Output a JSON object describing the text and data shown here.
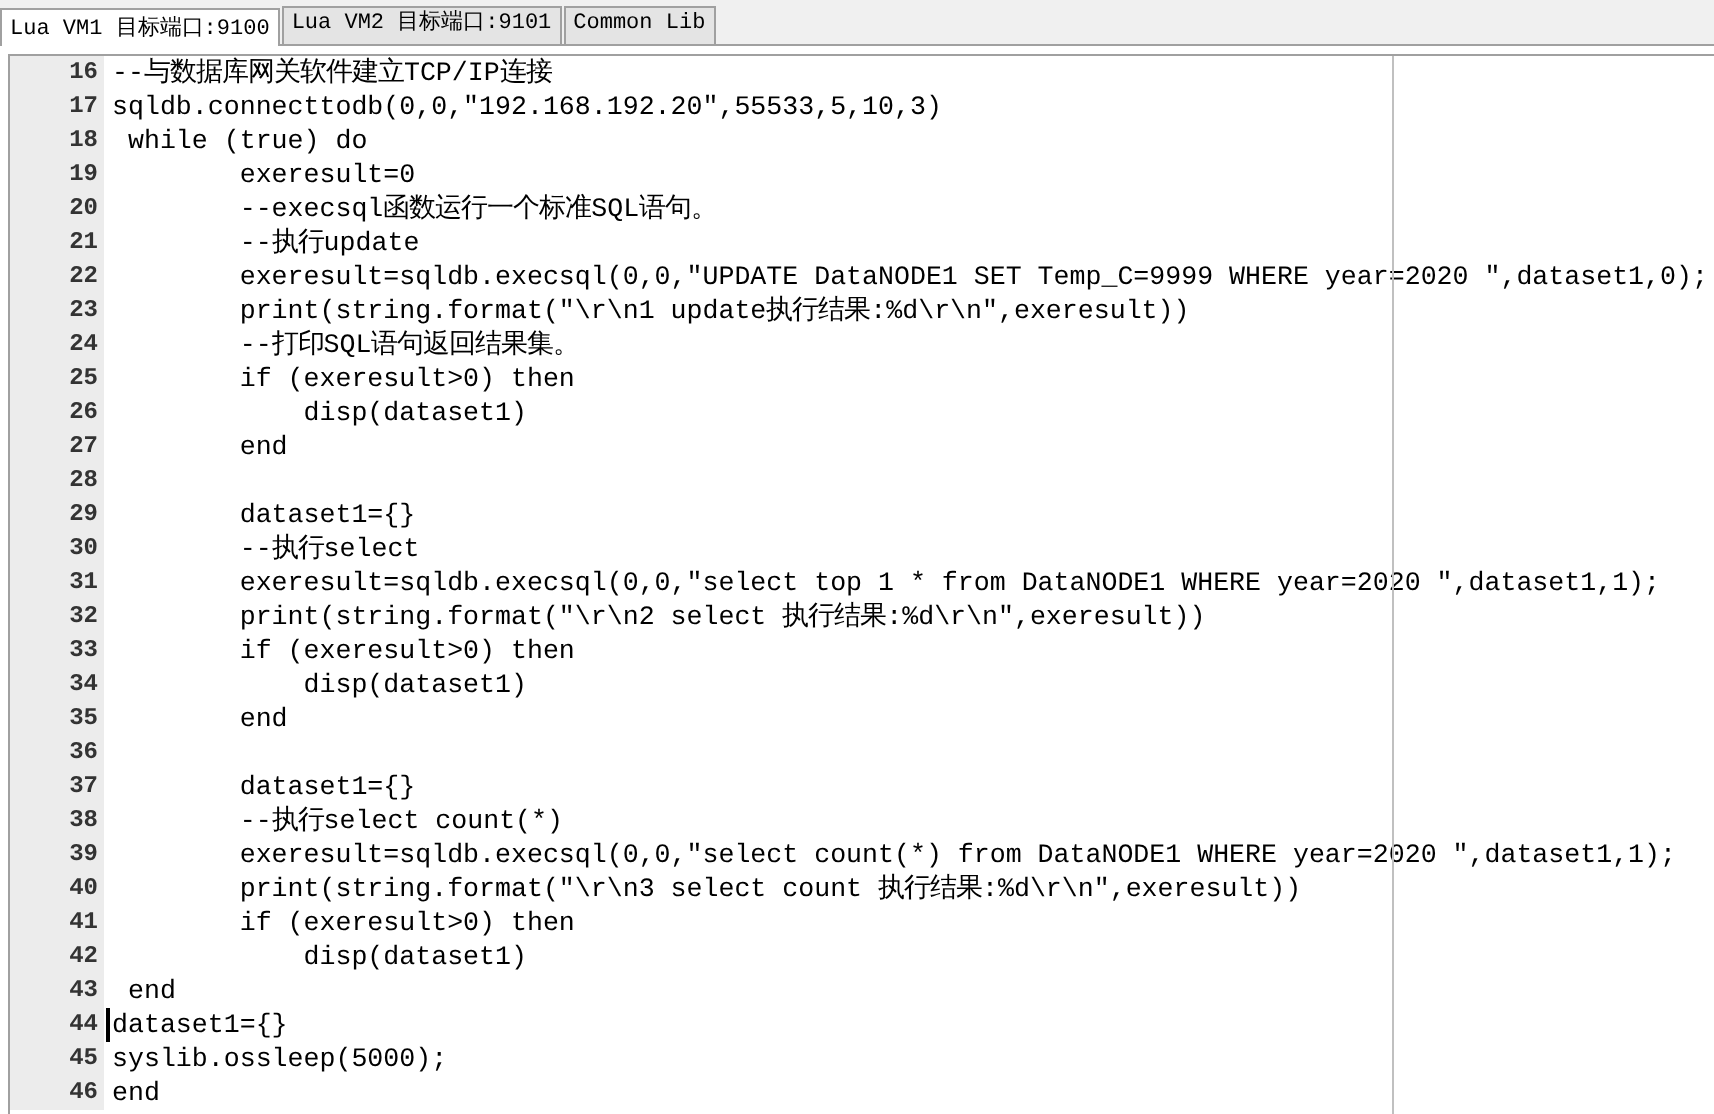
{
  "tabs": [
    {
      "label": "Lua VM1 目标端口:9100",
      "selected": true
    },
    {
      "label": "Lua VM2 目标端口:9101",
      "selected": false
    },
    {
      "label": "Common Lib",
      "selected": false
    }
  ],
  "editor": {
    "lines": [
      {
        "number": "16",
        "text": "--与数据库网关软件建立TCP/IP连接",
        "cursor": false
      },
      {
        "number": "17",
        "text": "sqldb.connecttodb(0,0,\"192.168.192.20\",55533,5,10,3)",
        "cursor": false
      },
      {
        "number": "18",
        "text": " while (true) do",
        "cursor": false
      },
      {
        "number": "19",
        "text": "        exeresult=0",
        "cursor": false
      },
      {
        "number": "20",
        "text": "        --execsql函数运行一个标准SQL语句。",
        "cursor": false
      },
      {
        "number": "21",
        "text": "        --执行update",
        "cursor": false
      },
      {
        "number": "22",
        "text": "        exeresult=sqldb.execsql(0,0,\"UPDATE DataNODE1 SET Temp_C=9999 WHERE year=2020 \",dataset1,0);",
        "cursor": false
      },
      {
        "number": "23",
        "text": "        print(string.format(\"\\r\\n1 update执行结果:%d\\r\\n\",exeresult))",
        "cursor": false
      },
      {
        "number": "24",
        "text": "        --打印SQL语句返回结果集。",
        "cursor": false
      },
      {
        "number": "25",
        "text": "        if (exeresult>0) then",
        "cursor": false
      },
      {
        "number": "26",
        "text": "            disp(dataset1)",
        "cursor": false
      },
      {
        "number": "27",
        "text": "        end",
        "cursor": false
      },
      {
        "number": "28",
        "cursor": false
      },
      {
        "number": "29",
        "text": "        dataset1={}",
        "cursor": false
      },
      {
        "number": "30",
        "text": "        --执行select",
        "cursor": false
      },
      {
        "number": "31",
        "text": "        exeresult=sqldb.execsql(0,0,\"select top 1 * from DataNODE1 WHERE year=2020 \",dataset1,1);",
        "cursor": false
      },
      {
        "number": "32",
        "text": "        print(string.format(\"\\r\\n2 select 执行结果:%d\\r\\n\",exeresult))",
        "cursor": false
      },
      {
        "number": "33",
        "text": "        if (exeresult>0) then",
        "cursor": false
      },
      {
        "number": "34",
        "text": "            disp(dataset1)",
        "cursor": false
      },
      {
        "number": "35",
        "text": "        end",
        "cursor": false
      },
      {
        "number": "36",
        "cursor": false
      },
      {
        "number": "37",
        "text": "        dataset1={}",
        "cursor": false
      },
      {
        "number": "38",
        "text": "        --执行select count(*)",
        "cursor": false
      },
      {
        "number": "39",
        "text": "        exeresult=sqldb.execsql(0,0,\"select count(*) from DataNODE1 WHERE year=2020 \",dataset1,1);",
        "cursor": false
      },
      {
        "number": "40",
        "text": "        print(string.format(\"\\r\\n3 select count 执行结果:%d\\r\\n\",exeresult))",
        "cursor": false
      },
      {
        "number": "41",
        "text": "        if (exeresult>0) then",
        "cursor": false
      },
      {
        "number": "42",
        "text": "            disp(dataset1)",
        "cursor": false
      },
      {
        "number": "43",
        "text": " end",
        "cursor": false
      },
      {
        "number": "44",
        "text": "dataset1={}",
        "cursor": true
      },
      {
        "number": "45",
        "text": "syslib.ossleep(5000);",
        "cursor": false
      },
      {
        "number": "46",
        "text": "end",
        "cursor": false
      }
    ]
  }
}
